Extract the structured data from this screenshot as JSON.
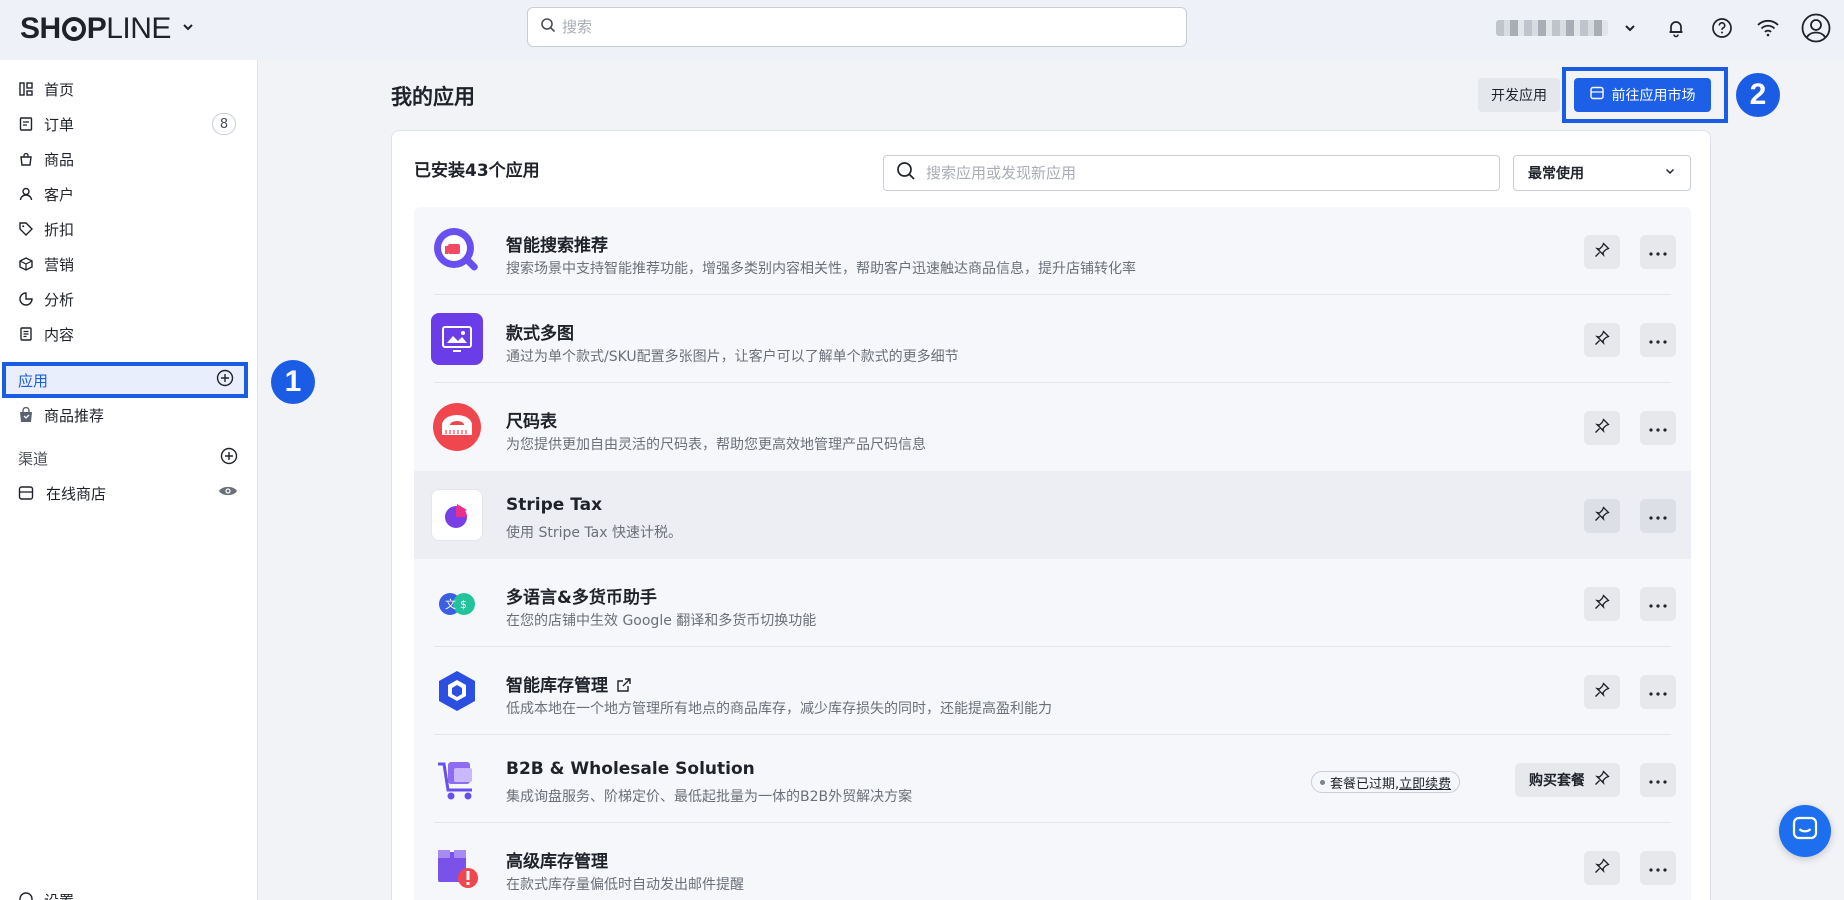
{
  "topbar": {
    "logo_bold_a": "SH",
    "logo_bold_b": "P",
    "logo_light": "LINE",
    "search_placeholder": "搜索",
    "icons": [
      "chevron-down-icon",
      "search-icon",
      "bell-icon",
      "help-icon",
      "wifi-icon",
      "account-icon"
    ]
  },
  "sidebar": {
    "items": [
      {
        "label": "首页",
        "icon": "home-icon"
      },
      {
        "label": "订单",
        "icon": "orders-icon",
        "badge": "8"
      },
      {
        "label": "商品",
        "icon": "products-icon"
      },
      {
        "label": "客户",
        "icon": "customers-icon"
      },
      {
        "label": "折扣",
        "icon": "discount-tag-icon"
      },
      {
        "label": "营销",
        "icon": "marketing-icon"
      },
      {
        "label": "分析",
        "icon": "analytics-icon"
      },
      {
        "label": "内容",
        "icon": "content-icon"
      }
    ],
    "apps_label": "应用",
    "product_rec_label": "商品推荐",
    "channels_label": "渠道",
    "online_store_label": "在线商店",
    "settings_label": "设置"
  },
  "steps": {
    "one": "1",
    "two": "2"
  },
  "main": {
    "page_title": "我的应用",
    "dev_button": "开发应用",
    "market_button": "前往应用市场",
    "installed_label": "已安装43个应用",
    "app_search_placeholder": "搜索应用或发现新应用",
    "sort_value": "最常使用"
  },
  "apps": [
    {
      "name": "智能搜索推荐",
      "desc": "搜索场景中支持智能推荐功能，增强多类别内容相关性，帮助客户迅速触达商品信息，提升店铺转化率"
    },
    {
      "name": "款式多图",
      "desc": "通过为单个款式/SKU配置多张图片，让客户可以了解单个款式的更多细节"
    },
    {
      "name": "尺码表",
      "desc": "为您提供更加自由灵活的尺码表，帮助您更高效地管理产品尺码信息"
    },
    {
      "name": "Stripe Tax",
      "desc": "使用 Stripe Tax 快速计税。"
    },
    {
      "name": "多语言&多货币助手",
      "desc": "在您的店铺中生效 Google 翻译和多货币切换功能"
    },
    {
      "name": "智能库存管理",
      "desc": "低成本地在一个地方管理所有地点的商品库存，减少库存损失的同时，还能提高盈利能力"
    },
    {
      "name": "B2B & Wholesale Solution",
      "desc": "集成询盘服务、阶梯定价、最低起批量为一体的B2B外贸解决方案",
      "status": "套餐已过期,",
      "status_link": "立即续费",
      "buy": "购买套餐"
    },
    {
      "name": "高级库存管理",
      "desc": "在款式库存量偏低时自动发出邮件提醒"
    }
  ],
  "colors": {
    "accent": "#1b5ce5",
    "background": "#f1f3f7"
  }
}
